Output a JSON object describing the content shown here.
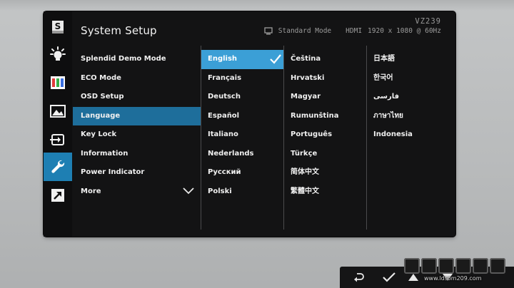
{
  "header": {
    "title": "System Setup",
    "model": "VZ239",
    "mode": "Standard Mode",
    "input": "HDMI",
    "resolution": "1920 x 1080 @ 60Hz"
  },
  "sidebar": {
    "icons": [
      {
        "name": "splendid-s-icon",
        "glyph": "S"
      },
      {
        "name": "brightness-icon"
      },
      {
        "name": "color-bars-icon"
      },
      {
        "name": "image-icon"
      },
      {
        "name": "input-select-icon"
      },
      {
        "name": "wrench-icon",
        "active": true
      },
      {
        "name": "shortcut-arrow-icon"
      }
    ],
    "active_color": "#1e7fb3"
  },
  "menu": {
    "items": [
      {
        "label": "Splendid Demo Mode"
      },
      {
        "label": "ECO Mode"
      },
      {
        "label": "OSD Setup"
      },
      {
        "label": "Language",
        "selected": true
      },
      {
        "label": "Key Lock"
      },
      {
        "label": "Information"
      },
      {
        "label": "Power Indicator"
      },
      {
        "label": "More"
      }
    ]
  },
  "languages": {
    "col1": [
      "English",
      "Français",
      "Deutsch",
      "Español",
      "Italiano",
      "Nederlands",
      "Русский",
      "Polski"
    ],
    "col2": [
      "Čeština",
      "Hrvatski",
      "Magyar",
      "Rumunština",
      "Português",
      "Türkçe",
      "简体中文",
      "繁體中文"
    ],
    "col3": [
      "日本語",
      "한국어",
      "فارسی",
      "ภาษาไทย",
      "Indonesia"
    ],
    "selected": "English",
    "selected_color": "#3b9fd6"
  },
  "buttons": [
    {
      "name": "back-icon"
    },
    {
      "name": "confirm-check-icon"
    },
    {
      "name": "up-arrow-icon"
    },
    {
      "name": "down-arrow-icon"
    }
  ],
  "watermark": {
    "url": "www.ldsom209.com"
  }
}
